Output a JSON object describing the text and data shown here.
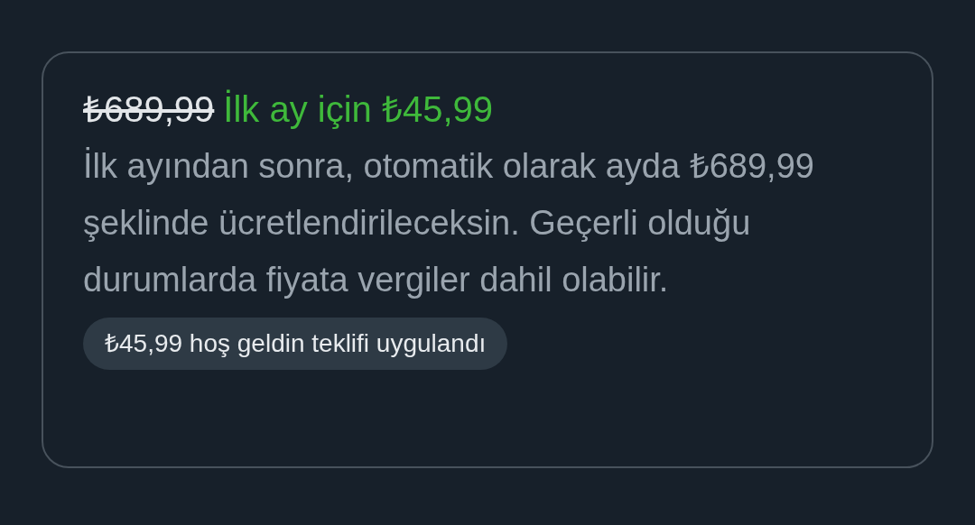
{
  "offer": {
    "old_price": "₺689,99",
    "promo": "İlk ay için ₺45,99",
    "description": "İlk ayından sonra, otomatik olarak ayda ₺689,99 şeklinde ücretlendirileceksin. Geçerli olduğu durumlarda fiyata vergiler dahil olabilir.",
    "badge": "₺45,99 hoş geldin teklifi uygulandı"
  }
}
